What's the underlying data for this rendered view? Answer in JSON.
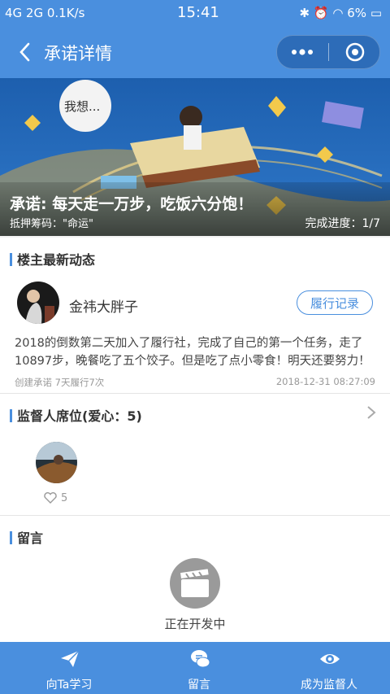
{
  "status_bar": {
    "left": "4G  2G  0.1K/s",
    "time": "15:41",
    "battery": "6%"
  },
  "nav": {
    "title": "承诺详情"
  },
  "banner": {
    "bubble_text": "我想...",
    "commitment": "承诺: 每天走一万步，吃饭六分饱！",
    "bet": "抵押筹码：\"命运\"",
    "progress": "完成进度：1/7"
  },
  "latest": {
    "heading": "楼主最新动态",
    "owner_name": "金祎大胖子",
    "record_button": "履行记录",
    "post_text": "2018的倒数第二天加入了履行社，完成了自己的第一个任务，走了10897步，晚餐吃了五个饺子。但是吃了点小零食！明天还要努力！",
    "meta": "创建承诺 7天履行7次",
    "time": "2018-12-31 08:27:09"
  },
  "supervisors": {
    "heading": "监督人席位(爱心：5)",
    "likes": "5"
  },
  "messages": {
    "heading": "留言",
    "status": "正在开发中"
  },
  "tabs": [
    {
      "label": "向Ta学习",
      "icon": "paper-plane-icon"
    },
    {
      "label": "留言",
      "icon": "chat-bubbles-icon"
    },
    {
      "label": "成为监督人",
      "icon": "eye-icon"
    }
  ],
  "colors": {
    "primary": "#4a8fde",
    "capsule": "#2d6cb8"
  }
}
